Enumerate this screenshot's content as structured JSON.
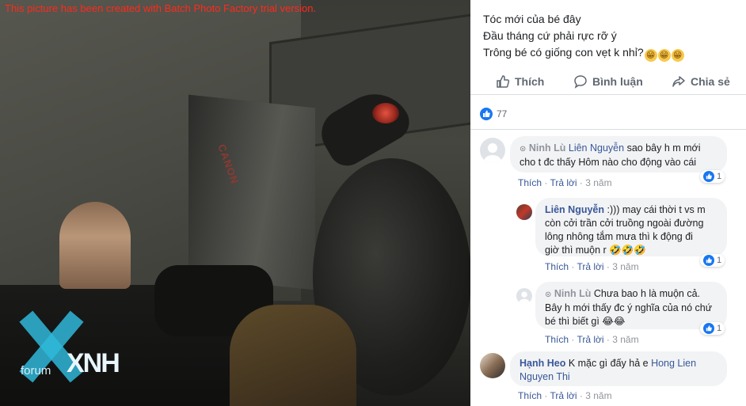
{
  "photo": {
    "trial_notice": "This picture has been created with Batch Photo Factory trial version.",
    "watermark_forum": "forum",
    "watermark_brand": "XNH",
    "softbox_brand": "CANON"
  },
  "post": {
    "caption_lines": [
      "Tóc mới của bé đây",
      "Đầu tháng cứ phải rực rỡ ý",
      "Trông bé có giống con vẹt k nhỉ?"
    ],
    "caption_emojis": [
      "😁",
      "😁",
      "😁"
    ],
    "actions": {
      "like": "Thích",
      "comment": "Bình luận",
      "share": "Chia sẻ"
    },
    "like_count": "77"
  },
  "comments": [
    {
      "author": "Ninh Lù",
      "mention": "Liên Nguyễn",
      "text_lines": [
        "sao bây h m mới",
        "cho t đc thấy Hôm nào cho động vào cái"
      ],
      "reactions": "1",
      "like": "Thích",
      "reply": "Trả lời",
      "time": "3 năm"
    },
    {
      "author": "Liên Nguyễn",
      "text_lines": [
        ":))) may cái thời t vs m",
        "còn cởi trần cởi truồng ngoài đường",
        "lông nhông tắm mưa thì k động đi",
        "giờ thì muộn r"
      ],
      "emoji": "🤣🤣🤣",
      "reactions": "1",
      "like": "Thích",
      "reply": "Trả lời",
      "time": "3 năm"
    },
    {
      "author": "Ninh Lù",
      "text_lines": [
        "Chưa bao h là muộn cả.",
        "Bây h mới thấy đc ý nghĩa của nó chứ",
        "bé thì biết gì"
      ],
      "emoji": "😂😂",
      "reactions": "1",
      "like": "Thích",
      "reply": "Trả lời",
      "time": "3 năm"
    },
    {
      "author": "Hạnh Heo",
      "text": "K mặc gì đấy hả e",
      "mention_line1": "Hong Lien",
      "mention_line2": "Nguyen Thi",
      "like": "Thích",
      "reply": "Trả lời",
      "time": "3 năm"
    }
  ],
  "colors": {
    "link": "#385898",
    "meta": "#90949c",
    "bubble": "#f2f3f5",
    "accent": "#1877f2",
    "trial_text": "#ff2a1a"
  }
}
